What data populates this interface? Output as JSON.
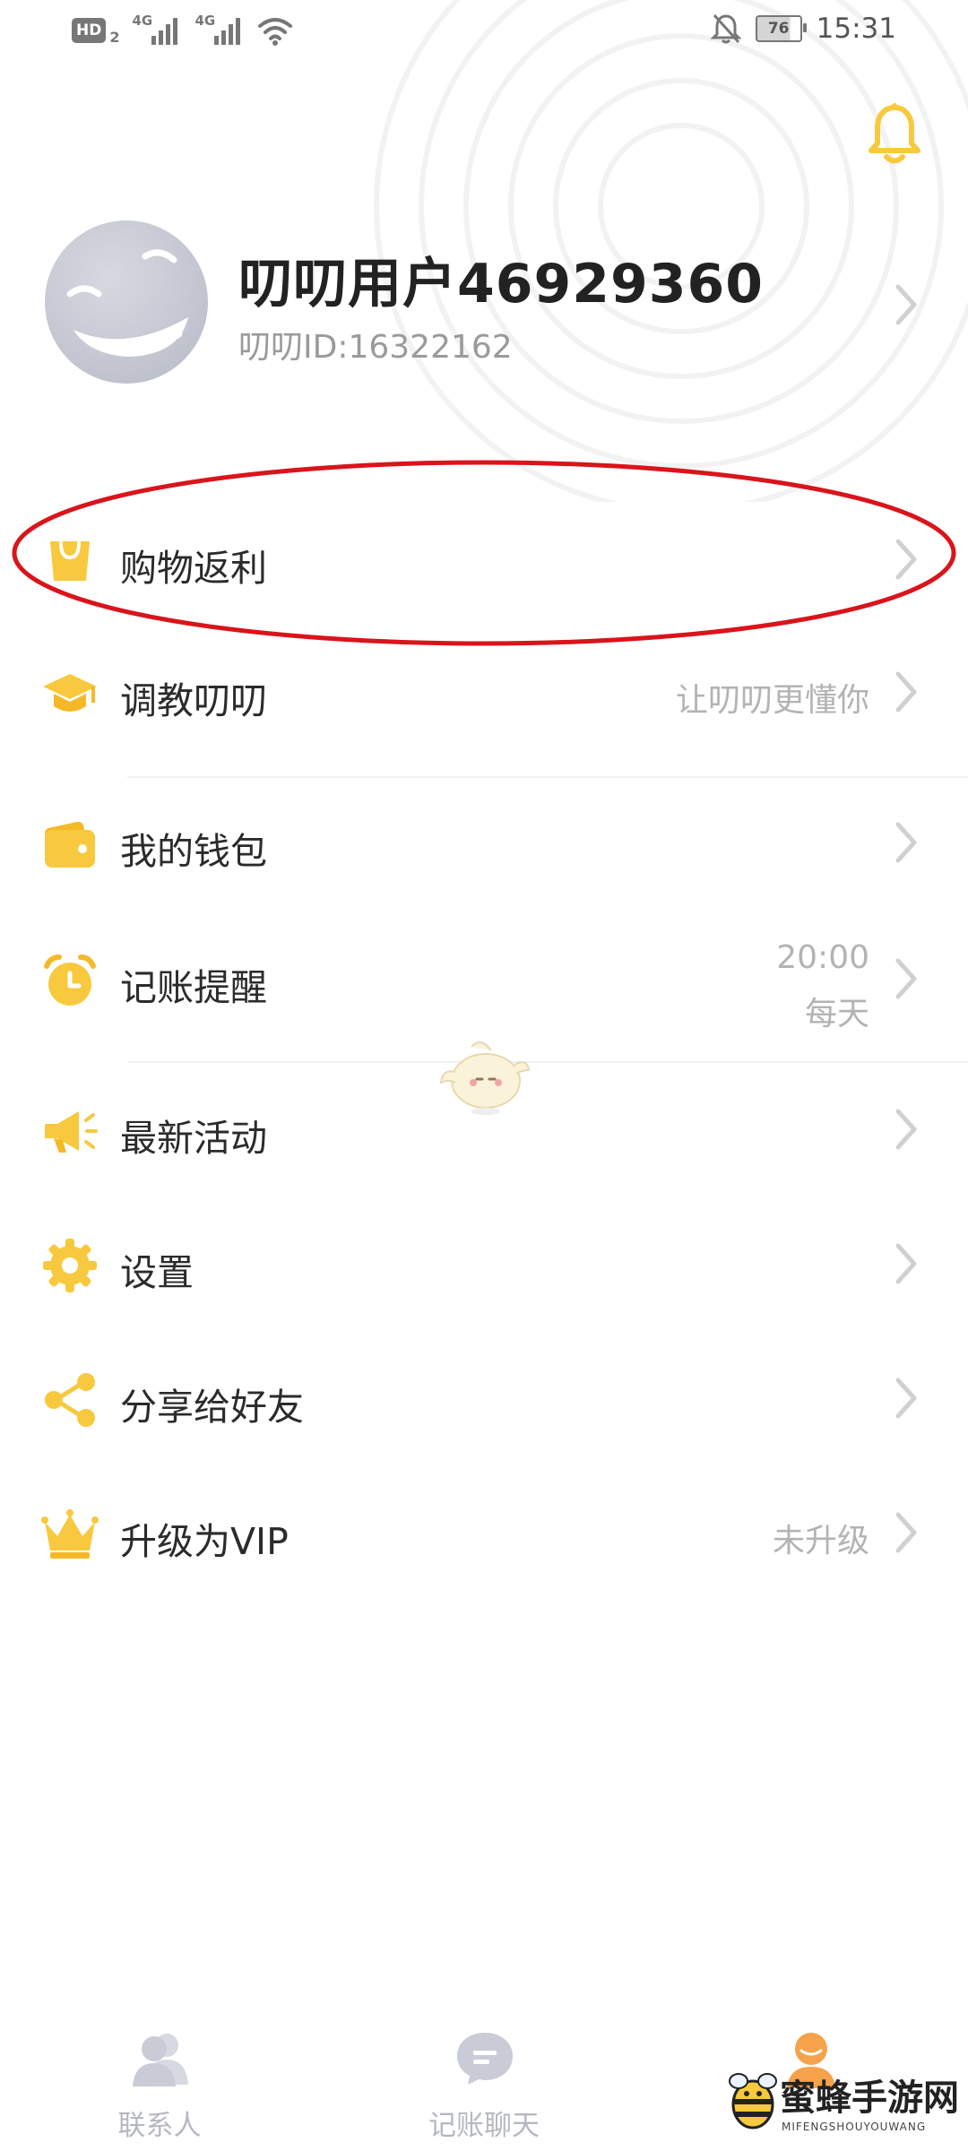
{
  "status_bar": {
    "hd_label": "HD",
    "hd_sub": "2",
    "network_1": "4G",
    "network_2": "4G",
    "battery": "76",
    "time": "15:31"
  },
  "profile": {
    "username": "叨叨用户46929360",
    "user_id": "叨叨ID:16322162"
  },
  "menu": [
    {
      "label": "购物返利",
      "hint": "",
      "icon": "shopping-bag-icon"
    },
    {
      "label": "调教叨叨",
      "hint": "让叨叨更懂你",
      "icon": "graduation-cap-icon"
    },
    {
      "label": "我的钱包",
      "hint": "",
      "icon": "wallet-icon"
    },
    {
      "label": "记账提醒",
      "hint_line1": "20:00",
      "hint_line2": "每天",
      "icon": "alarm-clock-icon"
    },
    {
      "label": "最新活动",
      "hint": "",
      "icon": "megaphone-icon"
    },
    {
      "label": "设置",
      "hint": "",
      "icon": "gear-icon"
    },
    {
      "label": "分享给好友",
      "hint": "",
      "icon": "share-icon"
    },
    {
      "label": "升级为VIP",
      "hint": "未升级",
      "icon": "crown-icon"
    }
  ],
  "bottom_nav": [
    {
      "label": "联系人",
      "icon": "contacts-icon"
    },
    {
      "label": "记账聊天",
      "icon": "chat-bubble-icon"
    },
    {
      "label": "",
      "icon": "profile-icon"
    }
  ],
  "watermark": {
    "text": "蜜蜂手游网",
    "sub": "MIFENGSHOUYOUWANG"
  },
  "colors": {
    "accent_yellow": "#F8C93E",
    "annotation_red": "#D9141B",
    "active_tab_orange": "#F6A24A",
    "inactive_tab": "#C9CCD6"
  }
}
